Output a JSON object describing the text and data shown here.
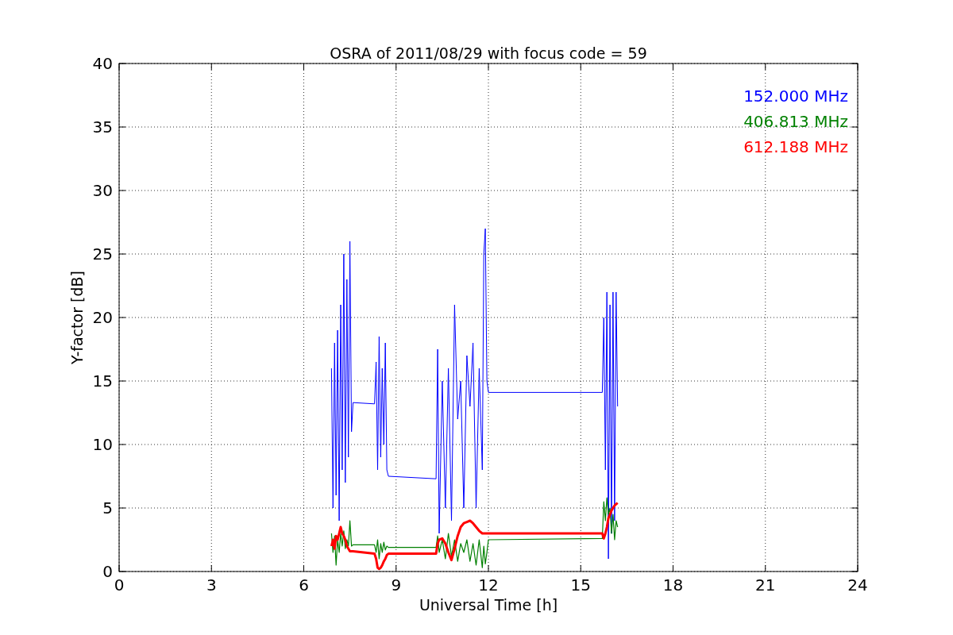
{
  "chart_data": {
    "type": "line",
    "grid": true,
    "title": "OSRA of 2011/08/29 with focus code = 59",
    "xlabel": "Universal Time [h]",
    "ylabel": "Y-factor [dB]",
    "xlim": [
      0,
      24
    ],
    "ylim": [
      0,
      40
    ],
    "xticks": [
      0,
      3,
      6,
      9,
      12,
      15,
      18,
      21,
      24
    ],
    "yticks": [
      0,
      5,
      10,
      15,
      20,
      25,
      30,
      35,
      40
    ],
    "x": [
      6.9,
      6.95,
      7.0,
      7.05,
      7.1,
      7.15,
      7.2,
      7.25,
      7.3,
      7.35,
      7.4,
      7.45,
      7.5,
      7.55,
      7.6,
      8.3,
      8.35,
      8.4,
      8.45,
      8.5,
      8.55,
      8.6,
      8.65,
      8.7,
      8.75,
      10.3,
      10.35,
      10.4,
      10.5,
      10.6,
      10.7,
      10.8,
      10.9,
      11.0,
      11.1,
      11.2,
      11.3,
      11.4,
      11.5,
      11.6,
      11.7,
      11.8,
      11.85,
      11.9,
      11.95,
      12.0,
      15.7,
      15.75,
      15.8,
      15.85,
      15.9,
      15.95,
      16.0,
      16.05,
      16.1,
      16.15,
      16.2
    ],
    "series": [
      {
        "name": "152.000 MHz",
        "color": "#0000ff",
        "values": [
          16,
          5,
          18,
          6,
          19,
          4,
          21,
          8,
          25,
          7,
          23,
          9,
          26,
          11,
          13.3,
          13.2,
          16.5,
          8,
          18.5,
          9,
          16,
          10,
          18,
          8,
          7.5,
          7.3,
          17.5,
          3,
          15,
          5,
          16,
          4,
          21,
          12,
          15,
          5,
          17,
          13,
          18,
          5,
          16,
          8,
          25,
          27,
          15,
          14.1,
          14.1,
          20,
          8,
          22,
          1,
          21,
          3,
          22,
          4,
          22,
          13
        ]
      },
      {
        "name": "406.813 MHz",
        "color": "#008000",
        "values": [
          3,
          1.5,
          2.8,
          0.5,
          2.5,
          1.5,
          3,
          2,
          3.2,
          1.8,
          2.5,
          2,
          4,
          2,
          2.1,
          2.1,
          1.5,
          2.5,
          1,
          2.2,
          1.5,
          2.3,
          1.7,
          2.0,
          1.9,
          1.9,
          2.8,
          1.5,
          2.5,
          1,
          3,
          1.2,
          2.5,
          0.8,
          2.2,
          1.5,
          2.5,
          0.8,
          2.2,
          0.5,
          2.5,
          0.3,
          2,
          0.6,
          1.5,
          2.5,
          2.6,
          5.5,
          4,
          5.8,
          4.5,
          5,
          3,
          4.5,
          2.5,
          4,
          3.5
        ]
      },
      {
        "name": "612.188 MHz",
        "color": "#ff0000",
        "values": [
          2,
          2.5,
          1.8,
          2.8,
          2.5,
          3,
          3.5,
          3,
          2.8,
          2.5,
          2,
          1.8,
          1.6,
          1.6,
          1.6,
          1.4,
          1,
          0.3,
          0.2,
          0.3,
          0.5,
          0.8,
          1,
          1.3,
          1.4,
          1.4,
          2.2,
          2.5,
          2.6,
          2.2,
          1.5,
          0.9,
          1.8,
          2.8,
          3.5,
          3.8,
          3.9,
          4,
          3.8,
          3.5,
          3.2,
          3,
          3,
          3,
          3,
          3,
          3,
          2.6,
          3,
          3.5,
          4.2,
          4.5,
          4.8,
          5,
          5.2,
          5.3,
          5.4
        ]
      }
    ]
  }
}
